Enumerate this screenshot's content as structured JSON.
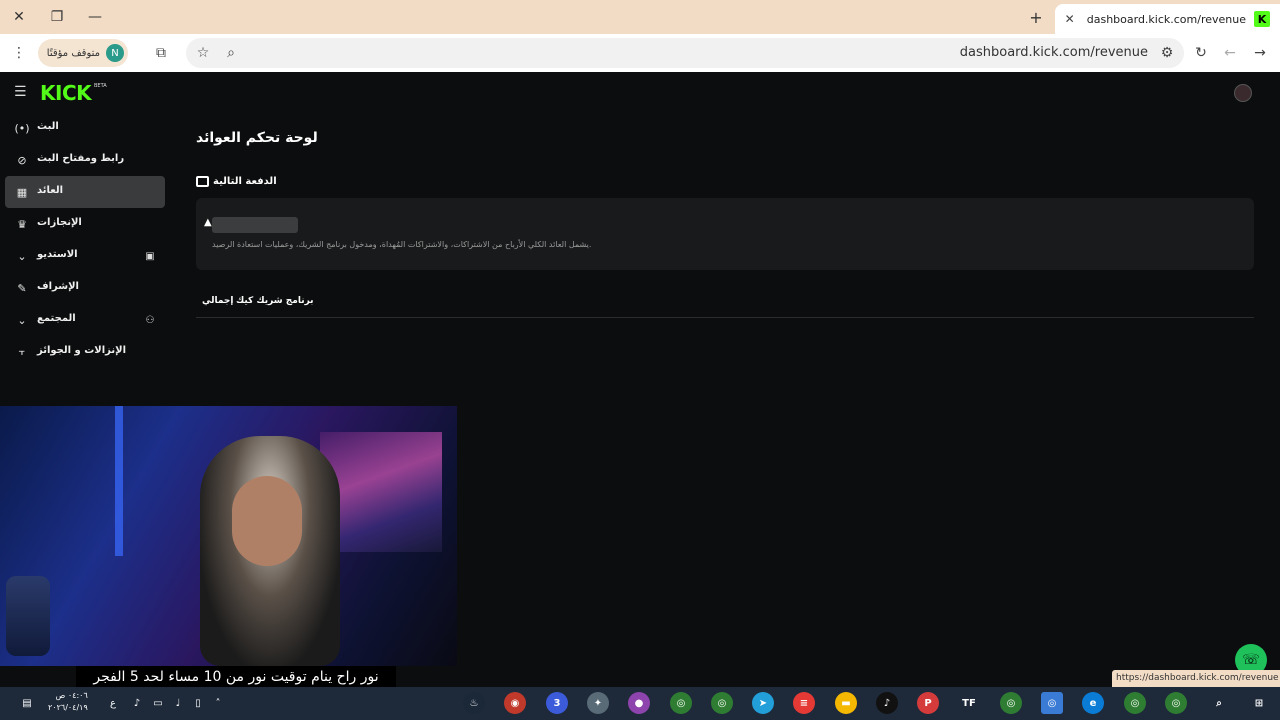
{
  "browser": {
    "tab_title": "dashboard.kick.com/revenue",
    "tab_favicon": "K",
    "url": "dashboard.kick.com/revenue",
    "profile_status": "متوقف مؤقتًا",
    "profile_initial": "N",
    "status_url": "https://dashboard.kick.com/revenue"
  },
  "kick": {
    "logo": "KICK",
    "beta": "BETA",
    "brand_color": "#53fc18"
  },
  "sidebar": {
    "items": [
      {
        "label": "البث",
        "icon": "broadcast-icon"
      },
      {
        "label": "رابط ومفتاح البث",
        "icon": "link-icon"
      },
      {
        "label": "العائد",
        "icon": "chart-icon",
        "active": true
      },
      {
        "label": "الإنجازات",
        "icon": "trophy-icon"
      },
      {
        "label": "الاستديو",
        "icon": "studio-icon"
      },
      {
        "label": "الإشراف",
        "icon": "wrench-icon"
      },
      {
        "label": "المجتمع",
        "icon": "community-icon"
      },
      {
        "label": "الإنزالات و الجوائز",
        "icon": "drops-icon"
      }
    ]
  },
  "main": {
    "page_title": "لوحة تحكم العوائد",
    "section_title": "الدفعة التالية",
    "card_note": "يشمل العائد الكلي الأرباح من الاشتراكات، والاشتراكات المُهداة، ومدخول برنامج الشريك، وعمليات استعادة الرصيد.",
    "tabs": [
      "برنامج شريك كيك",
      "إجمالي"
    ]
  },
  "overlay": {
    "subtitle": "نور راح ينام توقيت نور من 10 مساء لحد 5 الفجر"
  },
  "taskbar": {
    "time": "٠٤:٠٦ ص",
    "date": "٢٠٢٦/٠٤/١٩",
    "lang": "ع"
  }
}
